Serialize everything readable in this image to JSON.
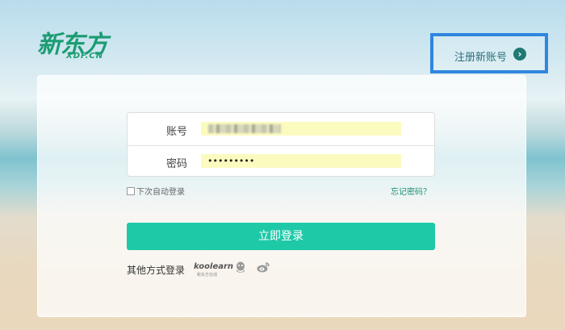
{
  "logo": {
    "text_cn": "新东方",
    "text_en": "XDF.CN"
  },
  "header": {
    "register_label": "注册新账号"
  },
  "form": {
    "username_label": "账号",
    "username_value": "",
    "password_label": "密码",
    "password_value": "•••••••••",
    "remember_label": "下次自动登录",
    "forgot_label": "忘记密码？",
    "login_label": "立即登录"
  },
  "social": {
    "other_label": "其他方式登录",
    "koolearn_text": "koolearn",
    "koolearn_sub": "新东方在线",
    "icons": [
      "koolearn-icon",
      "qq-icon",
      "weibo-icon"
    ]
  },
  "colors": {
    "brand_green": "#1b9c72",
    "button_teal": "#1ec9a8",
    "highlight_blue": "#2f86df",
    "autofill_yellow": "#fbfbc0"
  }
}
